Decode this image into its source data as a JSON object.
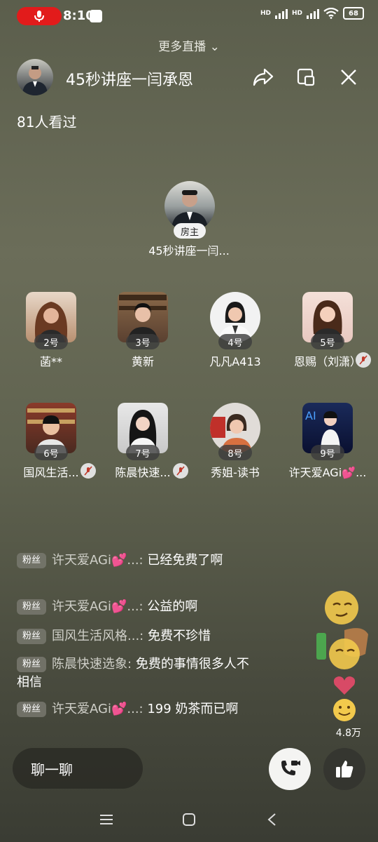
{
  "status": {
    "time": "8:10",
    "battery": "68",
    "net1": "HD",
    "net2": "HD"
  },
  "header": {
    "more_live": "更多直播",
    "room_title": "45秒讲座一闫承恩",
    "viewers": "81人看过"
  },
  "host": {
    "tag": "房主",
    "name": "45秒讲座一闫..."
  },
  "seats": [
    {
      "num": "2号",
      "name": "菡**"
    },
    {
      "num": "3号",
      "name": "黄新"
    },
    {
      "num": "4号",
      "name": "凡凡A413"
    },
    {
      "num": "5号",
      "name": "恩赐（刘潇）"
    },
    {
      "num": "6号",
      "name": "国风生活..."
    },
    {
      "num": "7号",
      "name": "陈晨快速..."
    },
    {
      "num": "8号",
      "name": "秀姐-读书"
    },
    {
      "num": "9号",
      "name": "许天爱AGi💕..."
    }
  ],
  "chat": [
    {
      "badge": "粉丝",
      "user": "许天爱AGi💕...:",
      "text": " 已经免费了啊"
    },
    {
      "badge": "粉丝",
      "user": "许天爱AGi💕...:",
      "text": " 公益的啊"
    },
    {
      "badge": "粉丝",
      "user": "国风生活风格...:",
      "text": " 免费不珍惜"
    },
    {
      "badge": "粉丝",
      "user": "陈晨快速选象:",
      "text": " 免费的事情很多人不相信"
    },
    {
      "badge": "粉丝",
      "user": "许天爱AGi💕...:",
      "text": " 199 奶茶而已啊"
    }
  ],
  "likes": "4.8万",
  "bottom": {
    "chat_placeholder": "聊一聊"
  },
  "colors": {
    "mic_pill": "#e21b1b",
    "mute_red": "#c0392b"
  }
}
